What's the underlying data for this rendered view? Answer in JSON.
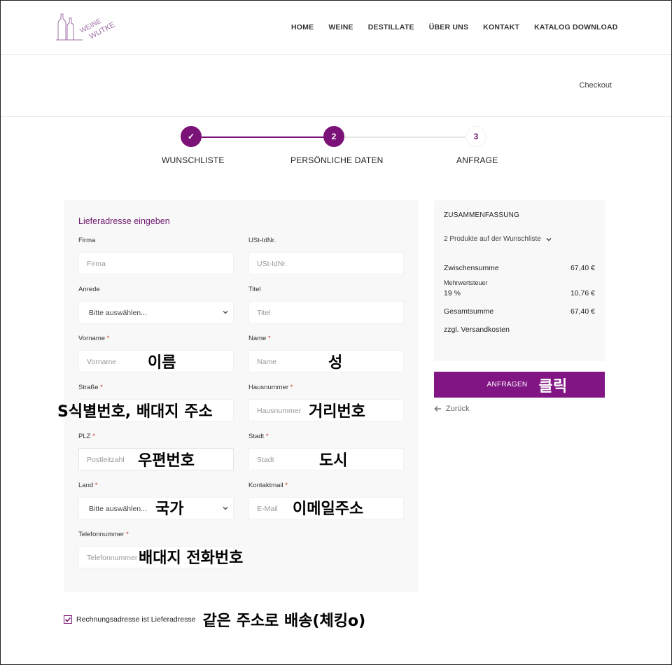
{
  "brand": {
    "line1": "WEINE",
    "line2": "WUTKE"
  },
  "nav": [
    "HOME",
    "WEINE",
    "DESTILLATE",
    "ÜBER UNS",
    "KONTAKT",
    "KATALOG DOWNLOAD"
  ],
  "breadcrumb": "Checkout",
  "steps": [
    {
      "label": "WUNSCHLISTE",
      "marker": "✓"
    },
    {
      "label": "PERSÖNLICHE DATEN",
      "marker": "2"
    },
    {
      "label": "ANFRAGE",
      "marker": "3"
    }
  ],
  "form": {
    "title": "Lieferadresse eingeben",
    "firma": {
      "label": "Firma",
      "placeholder": "Firma"
    },
    "ust": {
      "label": "USt-IdNr.",
      "placeholder": "USt-IdNr."
    },
    "anrede": {
      "label": "Anrede",
      "value": "Bitte auswählen..."
    },
    "titel": {
      "label": "Titel",
      "placeholder": "Titel"
    },
    "vorname": {
      "label": "Vorname",
      "placeholder": "Vorname",
      "note": "이름"
    },
    "name": {
      "label": "Name",
      "placeholder": "Name",
      "note": "성"
    },
    "strasse": {
      "label": "Straße",
      "note": "S식별번호, 배대지 주소"
    },
    "hausnummer": {
      "label": "Hausnummer",
      "placeholder": "Hausnummer",
      "note": "거리번호"
    },
    "plz": {
      "label": "PLZ",
      "placeholder": "Postleitzahl",
      "note": "우편번호"
    },
    "stadt": {
      "label": "Stadt",
      "placeholder": "Stadt",
      "note": "도시"
    },
    "land": {
      "label": "Land",
      "value": "Bitte auswählen...",
      "note": "국가"
    },
    "kontaktmail": {
      "label": "Kontaktmail",
      "placeholder": "E-Mail",
      "note": "이메일주소"
    },
    "telefon": {
      "label": "Telefonnummer",
      "placeholder": "Telefonnummer",
      "note": "배대지 전화번호"
    },
    "required_mark": "*"
  },
  "summary": {
    "title": "ZUSAMMENFASSUNG",
    "products": "2 Produkte auf der Wunschliste",
    "subtotal_label": "Zwischensumme",
    "subtotal_value": "67,40 €",
    "tax_label": "Mehrwertsteuer",
    "tax_rate": "19 %",
    "tax_value": "10,76 €",
    "total_label": "Gesamtsumme",
    "total_value": "67,40 €",
    "shipping_note": "zzgl. Versandkosten"
  },
  "actions": {
    "submit_label": "ANFRAGEN",
    "submit_note": "클릭",
    "back_label": "Zurück"
  },
  "billing": {
    "label": "Rechnungsadresse ist Lieferadresse",
    "checked": true,
    "note": "같은 주소로 배송(체킹o)"
  },
  "colors": {
    "accent": "#7a1278",
    "button": "#801583"
  }
}
